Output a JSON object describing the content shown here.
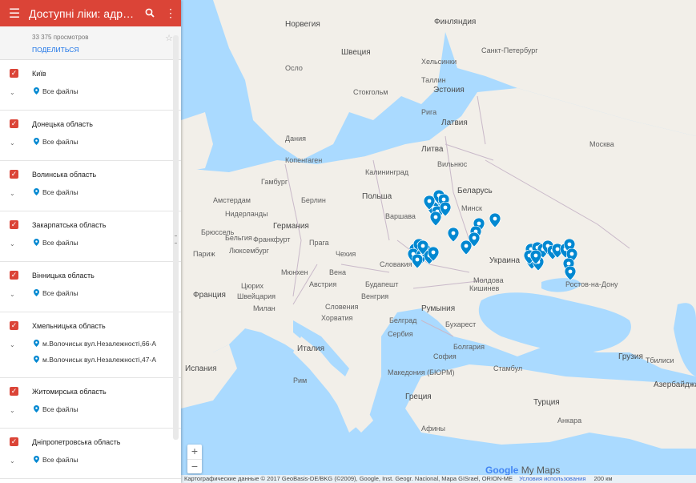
{
  "header": {
    "title": "Доступні ліки: адреси ...",
    "views": "33 375 просмотров",
    "share_label": "ПОДЕЛИТЬСЯ"
  },
  "layers": [
    {
      "name": "Київ",
      "items": [
        "Все файлы"
      ]
    },
    {
      "name": "Донецька область",
      "items": [
        "Все файлы"
      ]
    },
    {
      "name": "Волинська область",
      "items": [
        "Все файлы"
      ]
    },
    {
      "name": "Закарпатська область",
      "items": [
        "Все файлы"
      ]
    },
    {
      "name": "Вінницька область",
      "items": [
        "Все файлы"
      ]
    },
    {
      "name": "Хмельницька область",
      "items": [
        "м.Волочиськ вул.Незалежності,66-А",
        "м.Волочиськ вул.Незалежності,47-А"
      ]
    },
    {
      "name": "Житомирська область",
      "items": [
        "Все файлы"
      ]
    },
    {
      "name": "Дніпропетровська область",
      "items": [
        "Все файлы"
      ]
    }
  ],
  "map": {
    "countries": [
      "Финляндия",
      "Норвегия",
      "Эстония",
      "Латвия",
      "Литва",
      "Польша",
      "Беларусь",
      "Германия",
      "Украина",
      "Франция",
      "Румыния",
      "Италия",
      "Греция",
      "Турция",
      "Грузия",
      "Азербайджан",
      "Испания",
      "Швеция"
    ],
    "places": [
      "Хельсинки",
      "Санкт-Петербург",
      "Стокгольм",
      "Осло",
      "Рига",
      "Вильнюс",
      "Минск",
      "Москва",
      "Копенгаген",
      "Гамбург",
      "Берлин",
      "Варшава",
      "Амстердам",
      "Брюссель",
      "Франкфурт",
      "Прага",
      "Париж",
      "Вена",
      "Будапешт",
      "Кишинев",
      "Бухарест",
      "Белград",
      "София",
      "Рим",
      "Афины",
      "Анкара",
      "Стамбул",
      "Тбилиси",
      "Мюнхен",
      "Цюрих",
      "Милан",
      "Сербия",
      "Хорватия",
      "Македония (БЮРМ)",
      "Чехия",
      "Австрия",
      "Венгрия",
      "Словакия",
      "Швейцария",
      "Бельгия",
      "Нидерланды",
      "Дания",
      "Болгария",
      "Молдова",
      "Люксембург",
      "Словения",
      "Калининград",
      "Таллин",
      "Ростов-на-Дону"
    ],
    "zoom_in": "+",
    "zoom_out": "−",
    "brand_google": "Google",
    "brand_mymaps": "My Maps",
    "attribution": "Картографические данные © 2017 GeoBasis-DE/BKG (©2009), Google, Inst. Geogr. Nacional, Mapa GISrael, ORION-ME",
    "terms": "Условия использования",
    "scale": "200 км"
  },
  "colors": {
    "accent": "#db4437",
    "pin": "#0288d1",
    "water": "#aadaff",
    "land": "#f2efe9"
  }
}
